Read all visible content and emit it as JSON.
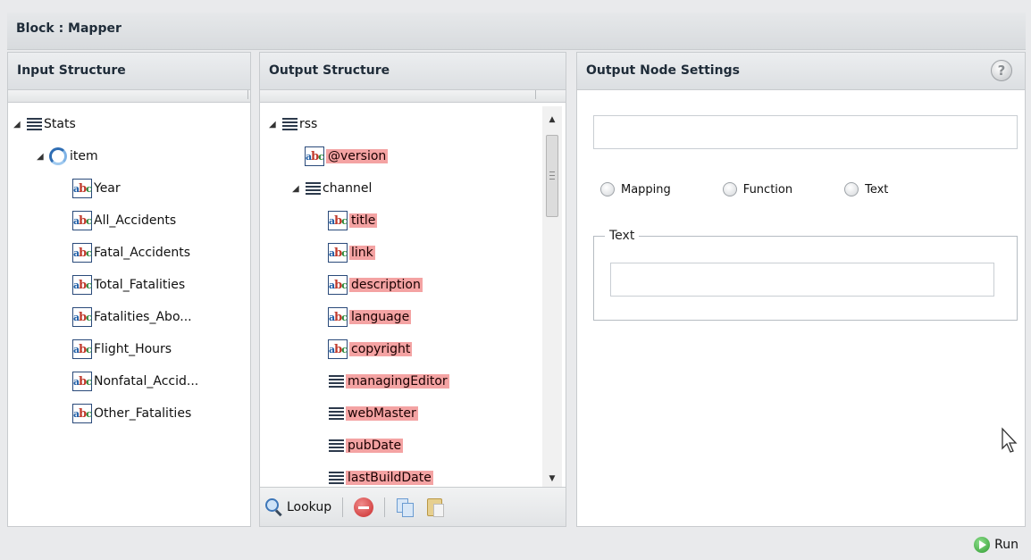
{
  "window": {
    "title": "Block : Mapper"
  },
  "input_panel": {
    "header": "Input Structure",
    "tree": [
      {
        "label": "Stats",
        "kind": "list",
        "depth": 0,
        "expanded": true
      },
      {
        "label": "item",
        "kind": "loop",
        "depth": 1,
        "expanded": true
      },
      {
        "label": "Year",
        "kind": "abc",
        "depth": 2
      },
      {
        "label": "All_Accidents",
        "kind": "abc",
        "depth": 2
      },
      {
        "label": "Fatal_Accidents",
        "kind": "abc",
        "depth": 2
      },
      {
        "label": "Total_Fatalities",
        "kind": "abc",
        "depth": 2
      },
      {
        "label": "Fatalities_Abo...",
        "kind": "abc",
        "depth": 2
      },
      {
        "label": "Flight_Hours",
        "kind": "abc",
        "depth": 2
      },
      {
        "label": "Nonfatal_Accid...",
        "kind": "abc",
        "depth": 2
      },
      {
        "label": "Other_Fatalities",
        "kind": "abc",
        "depth": 2
      }
    ]
  },
  "output_panel": {
    "header": "Output Structure",
    "tree": [
      {
        "label": "rss",
        "kind": "list",
        "depth": 0,
        "expanded": true,
        "highlight": false
      },
      {
        "label": "@version",
        "kind": "abc",
        "depth": 1,
        "highlight": true
      },
      {
        "label": "channel",
        "kind": "list",
        "depth": 1,
        "expanded": true,
        "highlight": false
      },
      {
        "label": "title",
        "kind": "abc",
        "depth": 2,
        "highlight": true
      },
      {
        "label": "link",
        "kind": "abc",
        "depth": 2,
        "highlight": true
      },
      {
        "label": "description",
        "kind": "abc",
        "depth": 2,
        "highlight": true
      },
      {
        "label": "language",
        "kind": "abc",
        "depth": 2,
        "highlight": true
      },
      {
        "label": "copyright",
        "kind": "abc",
        "depth": 2,
        "highlight": true
      },
      {
        "label": "managingEditor",
        "kind": "list",
        "depth": 2,
        "highlight": true
      },
      {
        "label": "webMaster",
        "kind": "list",
        "depth": 2,
        "highlight": true
      },
      {
        "label": "pubDate",
        "kind": "list",
        "depth": 2,
        "highlight": true
      },
      {
        "label": "lastBuildDate",
        "kind": "list",
        "depth": 2,
        "highlight": true
      }
    ],
    "toolbar": {
      "lookup_label": "Lookup"
    },
    "scroll_position": 0
  },
  "settings_panel": {
    "header": "Output Node Settings",
    "help_icon": "?",
    "name_field_value": "",
    "radio_options": [
      {
        "label": "Mapping",
        "selected": false
      },
      {
        "label": "Function",
        "selected": false
      },
      {
        "label": "Text",
        "selected": false
      }
    ],
    "text_group": {
      "legend": "Text",
      "value": ""
    }
  },
  "footer": {
    "run_label": "Run"
  },
  "colors": {
    "highlight": "#f4a3a3",
    "accent_blue": "#2e6db3",
    "run_green": "#2e9a2e"
  }
}
